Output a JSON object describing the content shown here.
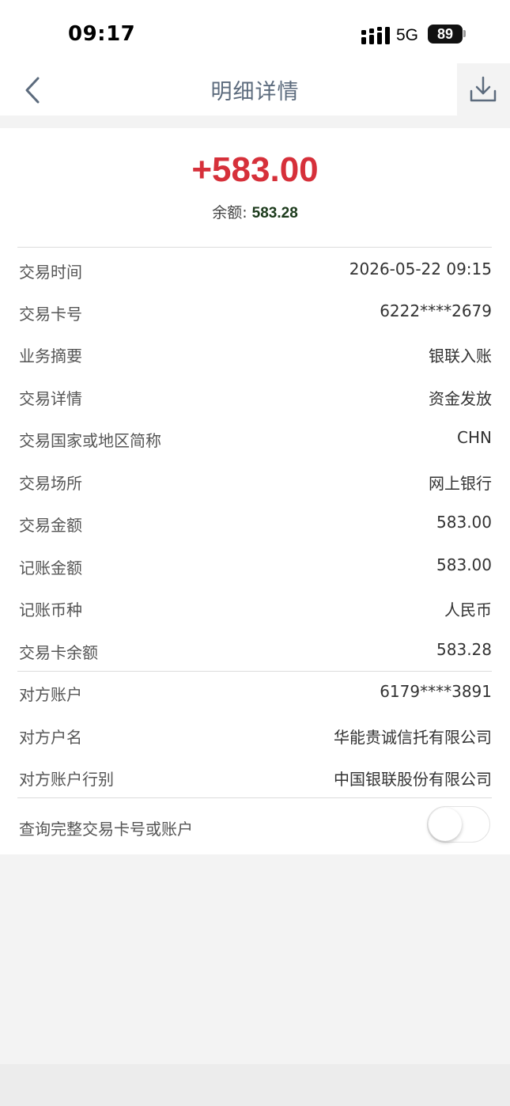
{
  "status_bar": {
    "time": "09:17",
    "network": "5G",
    "battery": "89"
  },
  "nav": {
    "title": "明细详情",
    "back_icon": "chevron-left-icon",
    "download_icon": "download-icon"
  },
  "summary": {
    "amount": "+583.00",
    "balance_label": "余额: ",
    "balance_value": "583.28",
    "amount_color": "#d6303a"
  },
  "details": [
    {
      "label": "交易时间",
      "value": "2026-05-22 09:15"
    },
    {
      "label": "交易卡号",
      "value": "6222****2679"
    },
    {
      "label": "业务摘要",
      "value": "银联入账"
    },
    {
      "label": "交易详情",
      "value": "资金发放"
    },
    {
      "label": "交易国家或地区简称",
      "value": "CHN"
    },
    {
      "label": "交易场所",
      "value": "网上银行"
    },
    {
      "label": "交易金额",
      "value": "583.00"
    },
    {
      "label": "记账金额",
      "value": "583.00"
    },
    {
      "label": "记账币种",
      "value": "人民币"
    },
    {
      "label": "交易卡余额",
      "value": "583.28"
    }
  ],
  "counterparty": [
    {
      "label": "对方账户",
      "value": "6179****3891"
    },
    {
      "label": "对方户名",
      "value": "华能贵诚信托有限公司"
    },
    {
      "label": "对方账户行别",
      "value": "中国银联股份有限公司"
    }
  ],
  "toggle_row": {
    "label": "查询完整交易卡号或账户",
    "state": "off"
  }
}
